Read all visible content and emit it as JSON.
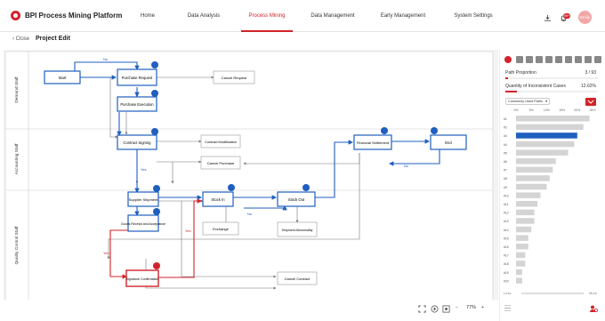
{
  "app": {
    "title": "BPI Process Mining Platform"
  },
  "nav": {
    "items": [
      "Home",
      "Data Analysis",
      "Process Mining",
      "Data Management",
      "Early Management",
      "System Settings"
    ],
    "active_index": 2
  },
  "header": {
    "notification_count": "99+",
    "user_name": "Emily"
  },
  "subbar": {
    "close_label": "Close",
    "page_title": "Project Edit"
  },
  "lanes": [
    "Demand Staff",
    "Accounting Staff",
    "Quality Control Staff"
  ],
  "process": {
    "nodes": {
      "start": "Start",
      "purchase_request": "Purchase Request",
      "purchase_execution": "Purchase Execution",
      "contract_signing": "Contract Signing",
      "supplier_shipment": "Supplier Shipment",
      "goods_receipt": "Goods Receipt and Acceptance",
      "signature_confirmation": "Signature Confirmation",
      "stock_in": "Stock In",
      "stock_out": "Stock Out",
      "financial_settlement": "Financial Settlement",
      "end": "End",
      "cancel_request": "Cancel Request",
      "contract_modification": "Contract Modification",
      "cancel_purchase": "Cancel Purchase",
      "exchange": "Exchange",
      "shipment_abnormality": "Shipment Abnormality",
      "cancel_contract": "Cancel Contract"
    },
    "edge_labels": {
      "no": "No",
      "yes": "Yes"
    }
  },
  "stats": {
    "path_proportion_label": "Path Proportion",
    "path_proportion_value": "3 / 93",
    "inconsistent_label": "Quantity of Inconsistent Cases",
    "inconsistent_value": "12.62%",
    "path_progress": 0.032,
    "inconsistent_progress": 0.126
  },
  "paths": {
    "dropdown_value": "Commonly Used Paths",
    "axis": [
      "0%",
      "5%",
      "10%",
      "15%",
      "20%",
      "25%"
    ],
    "rows": [
      "#1",
      "#2",
      "#3",
      "#4",
      "#5",
      "#6",
      "#7",
      "#8",
      "#9",
      "#10",
      "#11",
      "#12",
      "#13",
      "#14",
      "#15",
      "#16",
      "#17",
      "#18",
      "#19",
      "#20"
    ],
    "values": [
      24,
      22,
      20,
      19,
      17,
      13,
      12,
      11,
      10,
      8,
      7,
      6,
      6,
      5,
      4,
      4,
      3,
      3,
      2,
      2
    ],
    "selected_index": 2,
    "less_label": "Less",
    "more_label": "More"
  },
  "zoom": {
    "value": "77%"
  },
  "colors": {
    "accent": "#d2232a",
    "blue": "#1f5fbf",
    "gray": "#666666"
  }
}
